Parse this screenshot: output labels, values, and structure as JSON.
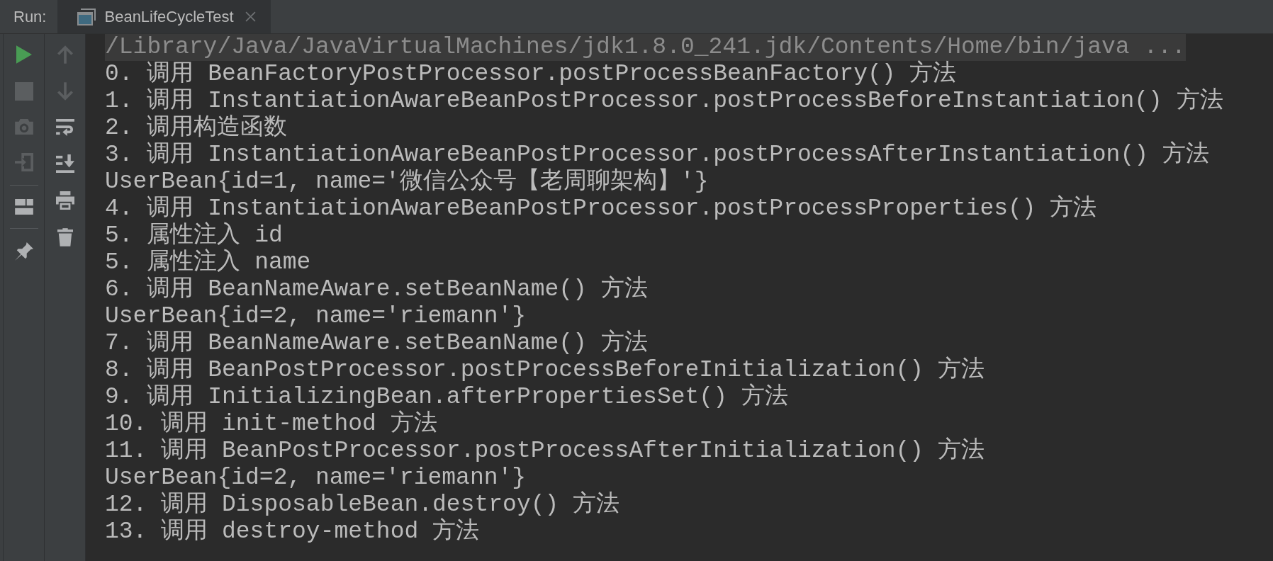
{
  "run_panel": {
    "label": "Run:",
    "tabs": [
      {
        "title": "BeanLifeCycleTest",
        "selected": true
      }
    ]
  },
  "toolbar_left": [
    [
      {
        "kind": "run",
        "disabled": false
      },
      {
        "kind": "stop",
        "disabled": true
      },
      {
        "kind": "camera",
        "disabled": true
      },
      {
        "kind": "export",
        "disabled": true
      }
    ],
    [
      {
        "kind": "layout",
        "disabled": false
      }
    ],
    [
      {
        "kind": "pin",
        "disabled": false
      }
    ]
  ],
  "toolbar_right": [
    {
      "kind": "up",
      "disabled": true
    },
    {
      "kind": "down",
      "disabled": true
    },
    {
      "kind": "wrap",
      "disabled": false
    },
    {
      "kind": "scroll_end",
      "disabled": false
    },
    {
      "kind": "print",
      "disabled": false
    },
    {
      "kind": "clear",
      "disabled": false
    }
  ],
  "console": {
    "lines": [
      {
        "kind": "command",
        "text": "/Library/Java/JavaVirtualMachines/jdk1.8.0_241.jdk/Contents/Home/bin/java ..."
      },
      {
        "kind": "output",
        "text": "0. 调用 BeanFactoryPostProcessor.postProcessBeanFactory() 方法"
      },
      {
        "kind": "output",
        "text": "1. 调用 InstantiationAwareBeanPostProcessor.postProcessBeforeInstantiation() 方法"
      },
      {
        "kind": "output",
        "text": "2. 调用构造函数"
      },
      {
        "kind": "output",
        "text": "3. 调用 InstantiationAwareBeanPostProcessor.postProcessAfterInstantiation() 方法"
      },
      {
        "kind": "output",
        "text": "UserBean{id=1, name='微信公众号【老周聊架构】'}"
      },
      {
        "kind": "output",
        "text": "4. 调用 InstantiationAwareBeanPostProcessor.postProcessProperties() 方法"
      },
      {
        "kind": "output",
        "text": "5. 属性注入 id"
      },
      {
        "kind": "output",
        "text": "5. 属性注入 name"
      },
      {
        "kind": "output",
        "text": "6. 调用 BeanNameAware.setBeanName() 方法"
      },
      {
        "kind": "output",
        "text": "UserBean{id=2, name='riemann'}"
      },
      {
        "kind": "output",
        "text": "7. 调用 BeanNameAware.setBeanName() 方法"
      },
      {
        "kind": "output",
        "text": "8. 调用 BeanPostProcessor.postProcessBeforeInitialization() 方法"
      },
      {
        "kind": "output",
        "text": "9. 调用 InitializingBean.afterPropertiesSet() 方法"
      },
      {
        "kind": "output",
        "text": "10. 调用 init-method 方法"
      },
      {
        "kind": "output",
        "text": "11. 调用 BeanPostProcessor.postProcessAfterInitialization() 方法"
      },
      {
        "kind": "output",
        "text": "UserBean{id=2, name='riemann'}"
      },
      {
        "kind": "output",
        "text": "12. 调用 DisposableBean.destroy() 方法"
      },
      {
        "kind": "output",
        "text": "13. 调用 destroy-method 方法"
      }
    ]
  }
}
